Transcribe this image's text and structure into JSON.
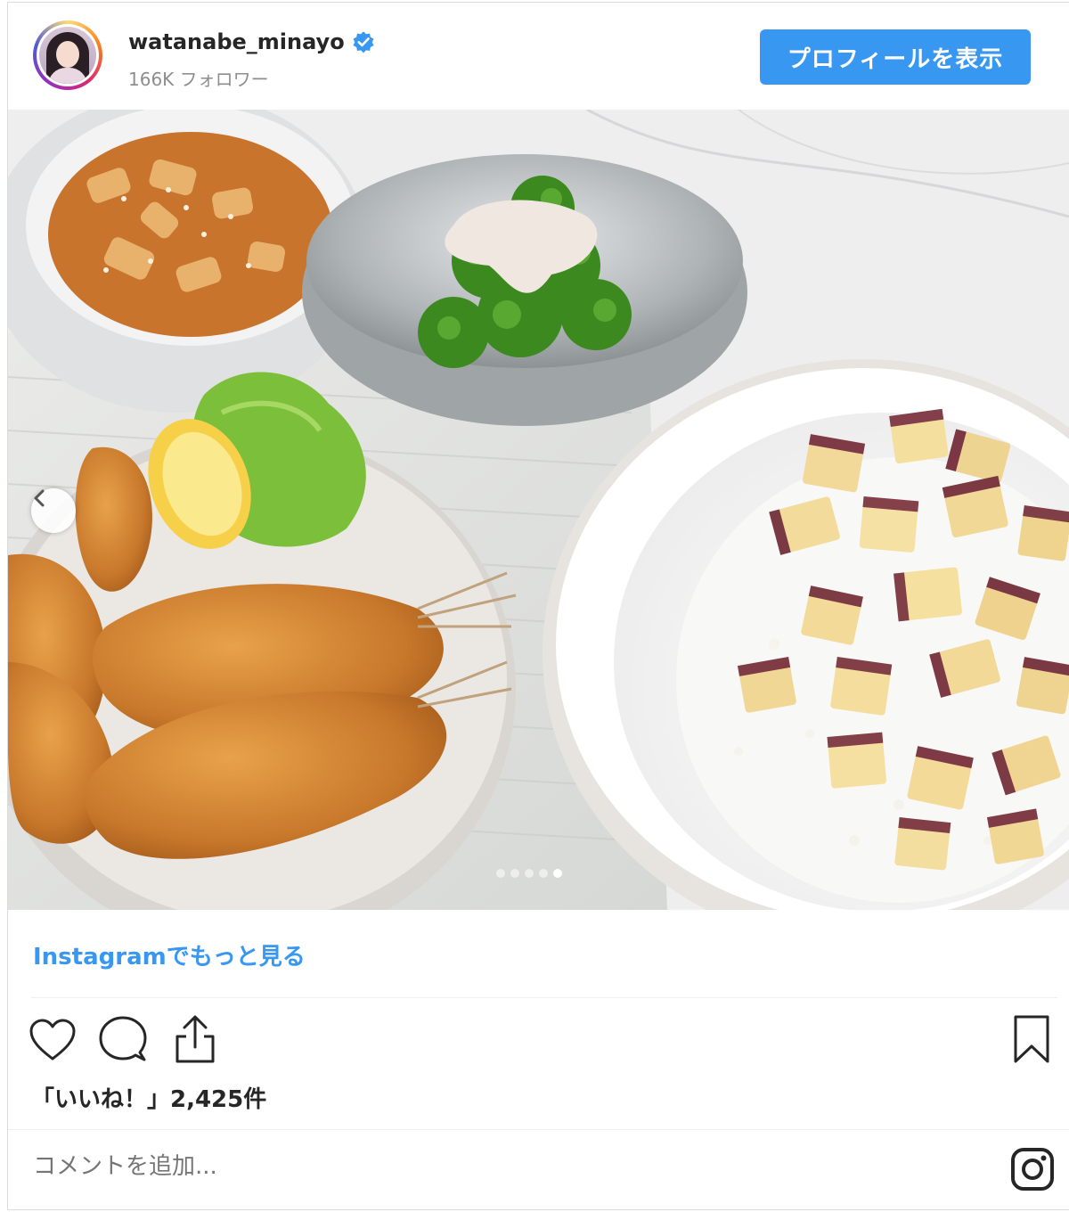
{
  "header": {
    "username": "watanabe_minayo",
    "followers": "166K フォロワー",
    "profile_button": "プロフィールを表示"
  },
  "post": {
    "carousel": {
      "dot_count": 5,
      "active_dot_index": 4
    },
    "more_link": "Instagramでもっと見る",
    "likes": "「いいね！」2,425件",
    "comment_placeholder": "コメントを追加..."
  },
  "colors": {
    "accent": "#3897f0",
    "verified": "#3897f0",
    "text": "#262626",
    "muted": "#8e8e8e"
  },
  "icons": {
    "verified": "verified-badge-icon",
    "prev": "chevron-left-icon",
    "like": "heart-icon",
    "comment": "comment-bubble-icon",
    "share": "share-upload-icon",
    "save": "bookmark-icon",
    "brand": "instagram-icon"
  }
}
